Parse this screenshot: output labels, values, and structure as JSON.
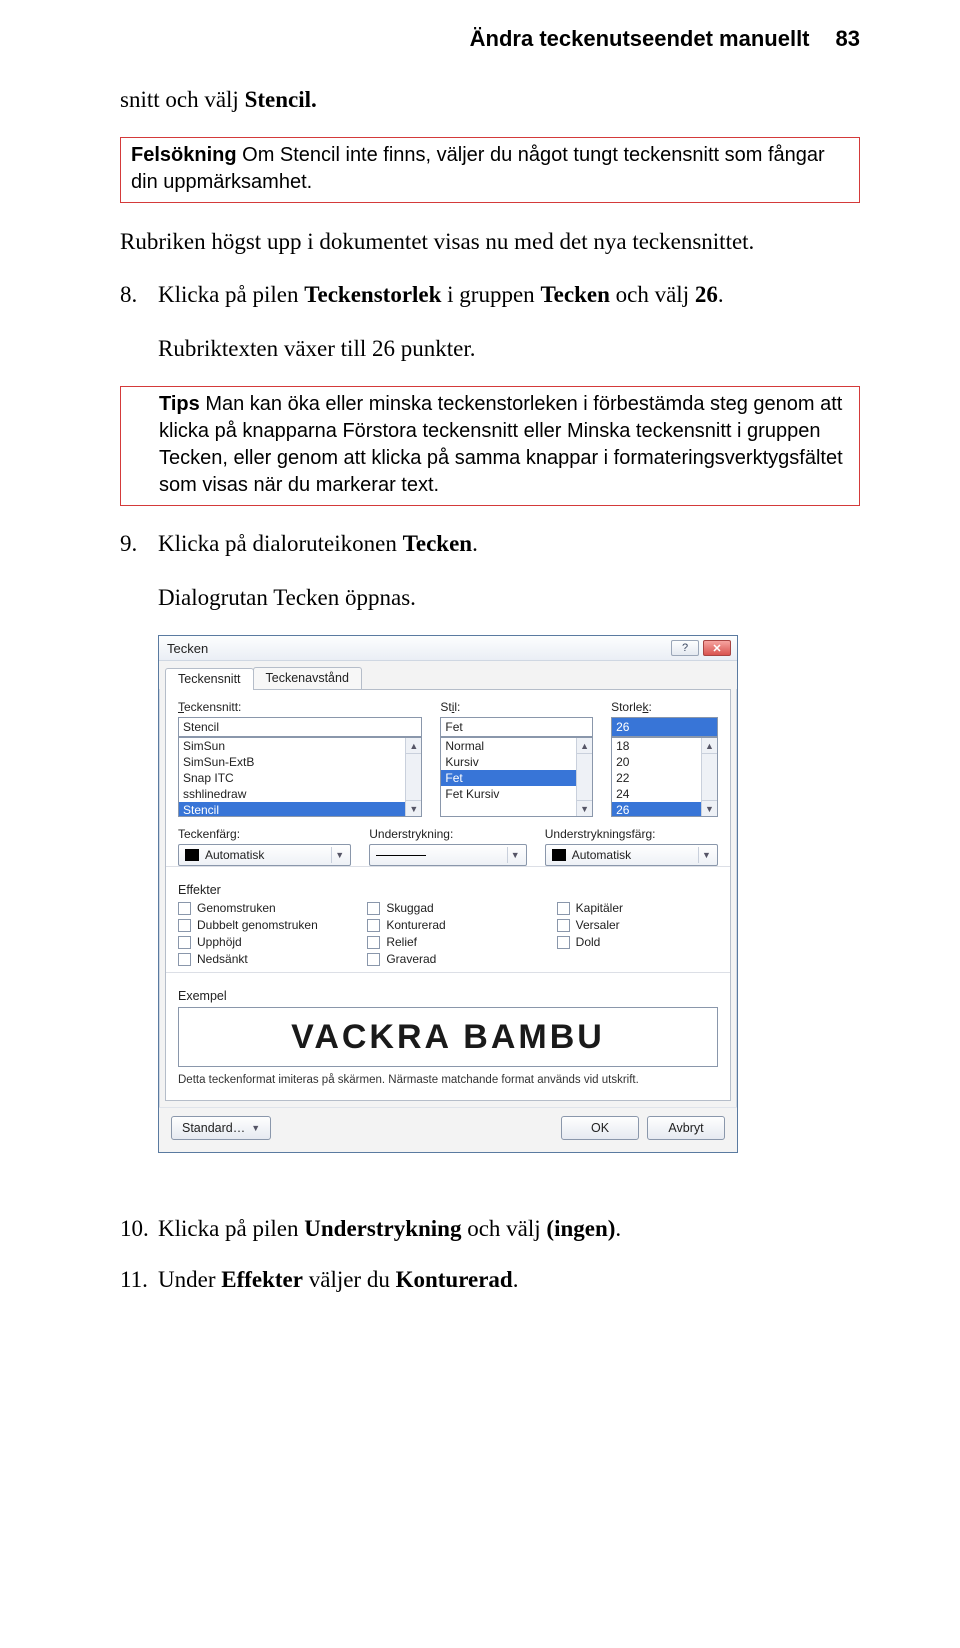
{
  "header": {
    "title": "Ändra teckenutseendet manuellt",
    "page_number": "83"
  },
  "para_intro": "snitt och välj ",
  "para_intro_bold": "Stencil.",
  "box1": {
    "lead": "Felsökning",
    "text": " Om Stencil inte finns, väljer du något tungt teckensnitt som fångar din uppmärksamhet."
  },
  "para_after_box1": "Rubriken högst upp i dokumentet visas nu med det nya teckensnittet.",
  "step8": {
    "num": "8.",
    "t1": "Klicka på pilen ",
    "b1": "Teckenstorlek",
    "t2": " i gruppen ",
    "b2": "Tecken",
    "t3": " och välj ",
    "b3": "26",
    "t4": "."
  },
  "para_after_step8": "Rubriktexten växer till 26 punkter.",
  "box2": {
    "lead": "Tips",
    "text": " Man kan öka eller minska teckenstorleken i förbestämda steg genom att klicka på knapparna Förstora teckensnitt eller Minska teckensnitt i gruppen Tecken, eller genom att klicka på samma knappar i formateringsverktygsfältet som visas när du markerar text."
  },
  "step9": {
    "num": "9.",
    "t1": "Klicka på dialoruteikonen ",
    "b1": "Tecken",
    "t2": "."
  },
  "para_after_step9": "Dialogrutan Tecken öppnas.",
  "dialog": {
    "title": "Tecken",
    "tabs": [
      "Teckensnitt",
      "Teckenavstånd"
    ],
    "labels": {
      "font": "Teckensnitt:",
      "style": "Stil:",
      "size": "Storlek:",
      "fontcolor": "Teckenfärg:",
      "underline": "Understrykning:",
      "underlinecolor": "Understrykningsfärg:",
      "effects": "Effekter",
      "example": "Exempel"
    },
    "font_value": "Stencil",
    "font_list": [
      "SimSun",
      "SimSun-ExtB",
      "Snap ITC",
      "sshlinedraw",
      "Stencil"
    ],
    "style_value": "Fet",
    "style_list": [
      "Normal",
      "Kursiv",
      "Fet",
      "Fet Kursiv"
    ],
    "size_value": "26",
    "size_list": [
      "18",
      "20",
      "22",
      "24",
      "26"
    ],
    "auto": "Automatisk",
    "effects_list": [
      "Genomstruken",
      "Skuggad",
      "Kapitäler",
      "Dubbelt genomstruken",
      "Konturerad",
      "Versaler",
      "Upphöjd",
      "Relief",
      "Dold",
      "Nedsänkt",
      "Graverad"
    ],
    "preview_text": "VACKRA BAMBU",
    "preview_note": "Detta teckenformat imiteras på skärmen. Närmaste matchande format används vid utskrift.",
    "buttons": {
      "standard": "Standard…",
      "ok": "OK",
      "cancel": "Avbryt"
    }
  },
  "step10": {
    "num": "10.",
    "t1": "Klicka på pilen ",
    "b1": "Understrykning",
    "t2": " och välj ",
    "b2": "(ingen)",
    "t3": "."
  },
  "step11": {
    "num": "11.",
    "t1": "Under ",
    "b1": "Effekter",
    "t2": " väljer du ",
    "b2": "Konturerad",
    "t3": "."
  }
}
